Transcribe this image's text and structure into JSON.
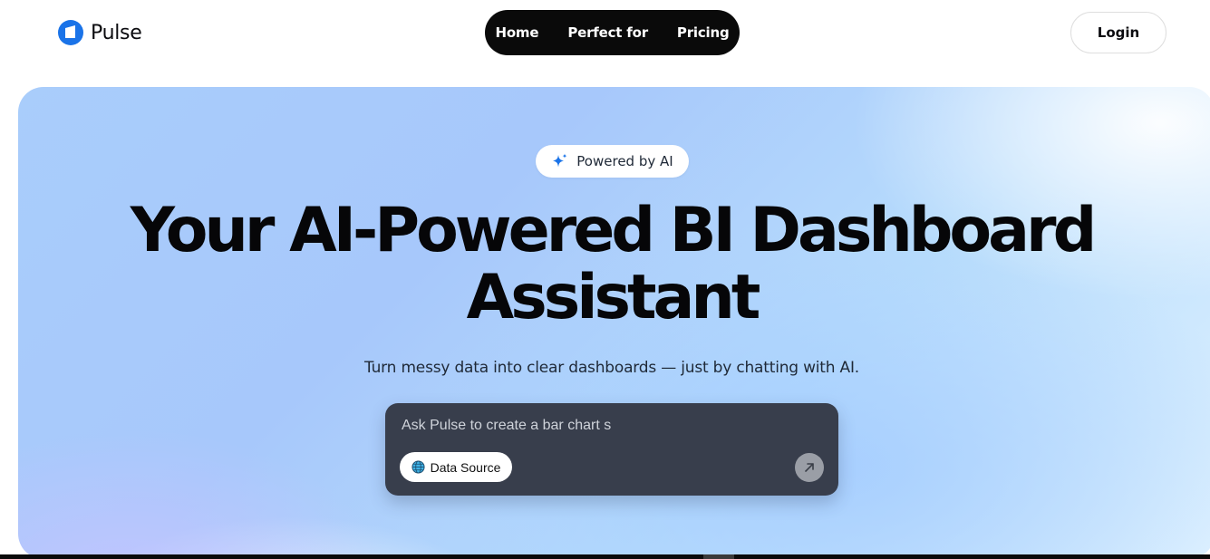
{
  "brand": {
    "name": "Pulse",
    "accent": "#1a73e8"
  },
  "nav": {
    "items": [
      {
        "label": "Home"
      },
      {
        "label": "Perfect for"
      },
      {
        "label": "Pricing"
      }
    ]
  },
  "header": {
    "login_label": "Login"
  },
  "hero": {
    "badge": "Powered by AI",
    "headline_line1": "Your AI-Powered BI Dashboard",
    "headline_line2": "Assistant",
    "subtitle": "Turn messy data into clear dashboards — just by chatting with AI."
  },
  "prompt": {
    "value": "Ask Pulse to create a bar chart s",
    "data_source_label": "Data Source",
    "send_icon": "arrow-up-right-icon"
  }
}
